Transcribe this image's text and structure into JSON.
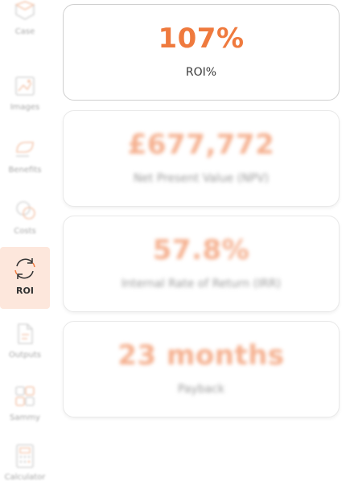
{
  "sidebar": {
    "items": [
      {
        "label": "Case",
        "icon": "case-icon"
      },
      {
        "label": "Images",
        "icon": "images-icon"
      },
      {
        "label": "Benefits",
        "icon": "benefits-icon"
      },
      {
        "label": "Costs",
        "icon": "costs-icon"
      },
      {
        "label": "ROI",
        "icon": "refresh-cycle-icon",
        "active": true
      },
      {
        "label": "Outputs",
        "icon": "document-icon"
      },
      {
        "label": "Sammy",
        "icon": "sammy-icon"
      },
      {
        "label": "Calculator",
        "icon": "calculator-icon"
      }
    ]
  },
  "metrics": [
    {
      "value": "107%",
      "label": "ROI%"
    },
    {
      "value": "£677,772",
      "label": "Net Present Value (NPV)"
    },
    {
      "value": "57.8%",
      "label": "Internal Rate of Return (IRR)"
    },
    {
      "value": "23 months",
      "label": "Payback"
    }
  ],
  "colors": {
    "accent": "#ef7a3e",
    "active_nav_bg": "#fde7dc"
  }
}
